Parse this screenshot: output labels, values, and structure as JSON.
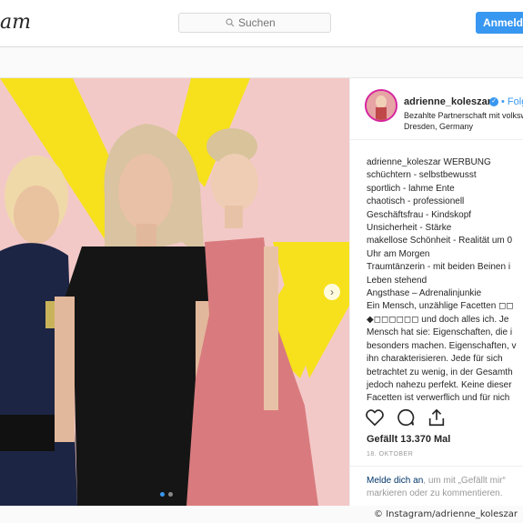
{
  "topbar": {
    "logo_text": "am",
    "search_placeholder": "Suchen",
    "login_label": "Anmelden"
  },
  "post": {
    "username": "adrienne_koleszar",
    "follow_label": "• Folgen",
    "partnership": "Bezahlte Partnerschaft mit volkswagen",
    "location": "Dresden, Germany",
    "caption_lines": [
      "WERBUNG",
      "schüchtern - selbstbewusst",
      "sportlich - lahme Ente",
      "chaotisch - professionell",
      "Geschäftsfrau - Kindskopf",
      "Unsicherheit - Stärke",
      "makellose Schönheit - Realität um 0",
      "Uhr am Morgen",
      "Traumtänzerin - mit beiden Beinen i",
      "Leben stehend",
      "Angsthase – Adrenalinjunkie",
      "Ein Mensch, unzählige Facetten ◻◻",
      "◆◻◻◻◻◻◻ und doch alles ich. Je",
      "Mensch hat sie: Eigenschaften, die i",
      "besonders machen. Eigenschaften, v",
      "ihn charakterisieren. Jede für sich",
      "betrachtet zu wenig, in der Gesamth",
      "jedoch nahezu perfekt. Keine dieser",
      "Facetten ist verwerflich und für nich"
    ],
    "likes": "Gefällt 13.370 Mal",
    "date": "18. OKTOBER",
    "login_link": "Melde dich an",
    "login_rest_1": ", um mit „Gefällt mir“",
    "login_rest_2": "markieren oder zu kommentieren."
  },
  "credit": "© Instagram/adrienne_koleszar",
  "colors": {
    "accent_blue": "#3897f0",
    "bg_pink": "#f3c9c8",
    "yellow": "#f6e11c",
    "dress_pink": "#d97b7e"
  },
  "icons": [
    "search-icon",
    "verified-icon",
    "chevron-right-icon",
    "heart-icon",
    "comment-icon",
    "share-icon"
  ]
}
